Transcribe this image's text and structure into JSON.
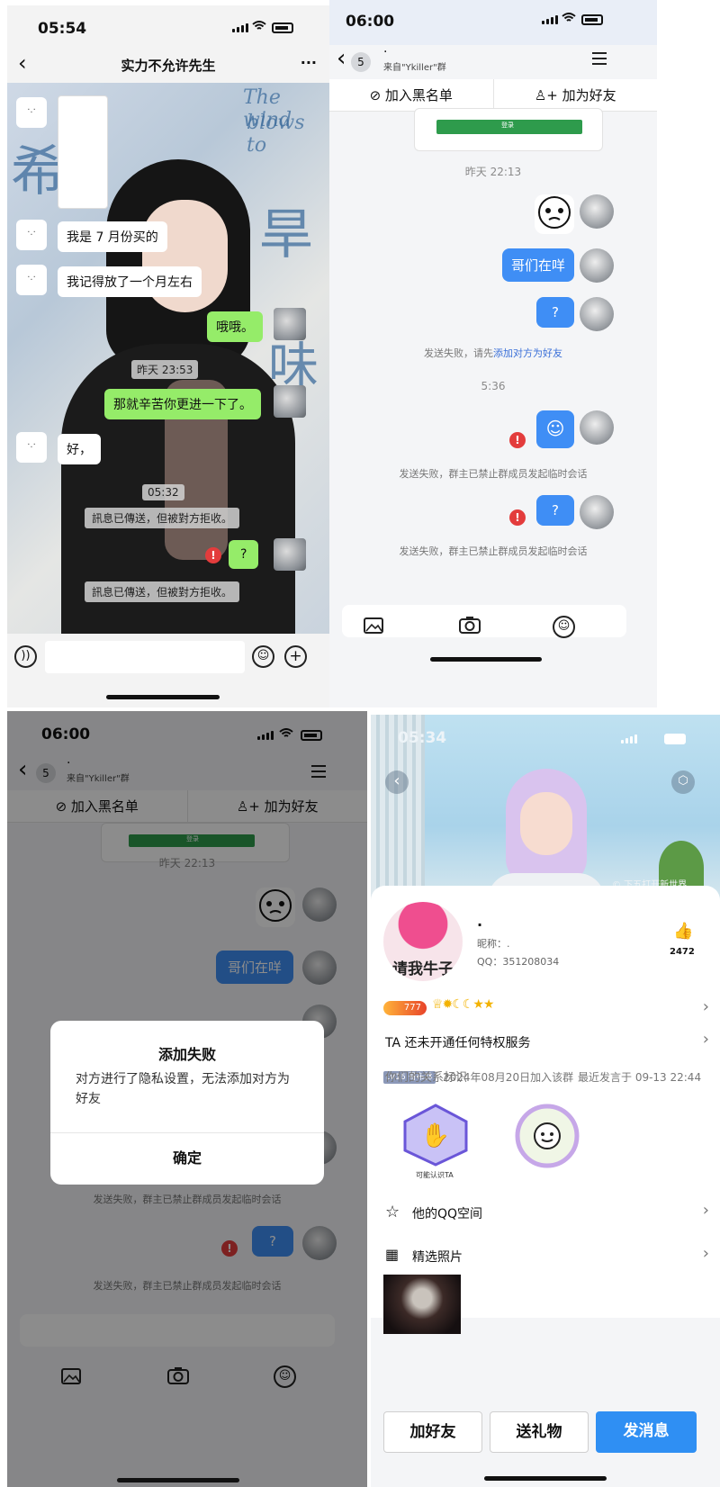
{
  "panel1": {
    "status": {
      "time": "05:54"
    },
    "nav": {
      "back": "‹",
      "title": "实力不允许先生",
      "more": "···"
    },
    "messages": {
      "m1": "我是 7 月份买的",
      "m2": "我记得放了一个月左右",
      "m3": "哦哦。",
      "ts1": "昨天 23:53",
      "m4": "那就辛苦你更进一下了。",
      "m5": "好，",
      "ts2": "05:32",
      "sys1": "訊息已傳送，但被對方拒收。",
      "m6": "?",
      "sys2": "訊息已傳送，但被對方拒收。"
    },
    "deco": {
      "t1": "The wind",
      "t2": "blows to"
    }
  },
  "panel2": {
    "status": {
      "time": "06:00"
    },
    "nav": {
      "count": "5",
      "name": "·",
      "from": "来自\"Ykiller\"群"
    },
    "actions": {
      "block": "加入黑名单",
      "add": "加为好友"
    },
    "card_btn": "登录",
    "ts1": "昨天 22:13",
    "bubble1": "哥们在咩",
    "bubble2": "?",
    "sys1_prefix": "发送失败，请先",
    "sys1_link": "添加对方为好友",
    "ts2": "5:36",
    "sys2": "发送失败，群主已禁止群成员发起临时会话",
    "bubble3": "?",
    "sys3": "发送失败，群主已禁止群成员发起临时会话"
  },
  "panel3": {
    "status": {
      "time": "06:00"
    },
    "nav": {
      "count": "5",
      "name": "·",
      "from": "来自\"Ykiller\"群"
    },
    "actions": {
      "block": "加入黑名单",
      "add": "加为好友"
    },
    "card_btn": "登录",
    "ts1": "昨天 22:13",
    "bubble1": "哥们在咩",
    "sys2": "发送失败，群主已禁止群成员发起临时会话",
    "bubble3": "?",
    "sys3": "发送失败，群主已禁止群成员发起临时会话",
    "dialog": {
      "title": "添加失败",
      "body": "对方进行了隐私设置，无法添加对方为好友",
      "confirm": "确定"
    }
  },
  "panel4": {
    "status": {
      "time": "05:34"
    },
    "hero_caption": "© 下五打开新世界",
    "avatar_text": "请我牛子",
    "profile": {
      "name": "·",
      "nickname": "昵称：.",
      "qq": "QQ：351208034",
      "likes": "2472"
    },
    "level_badge": "777",
    "privilege": "TA 还未开通任何特权服务",
    "group": {
      "badge": "LV16 哥布林",
      "joined": "2024年08月20日加入该群",
      "last": "最近发言于 09-13 22:44"
    },
    "relation_label": "你们的关系标识",
    "tag1": "可能认识TA",
    "qzone": "他的QQ空间",
    "photos": "精选照片",
    "buttons": {
      "add": "加好友",
      "gift": "送礼物",
      "msg": "发消息"
    }
  }
}
